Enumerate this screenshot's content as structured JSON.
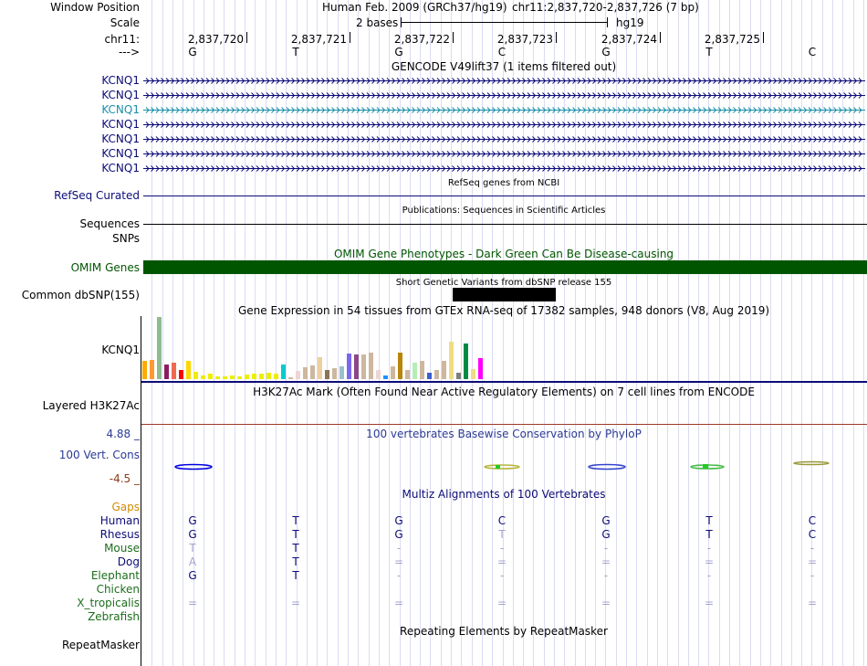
{
  "header": {
    "window_position_label": "Window Position",
    "assembly": "Human Feb. 2009 (GRCh37/hg19)",
    "position": "chr11:2,837,720-2,837,726 (7 bp)",
    "scale_label": "Scale",
    "scale_text": "2 bases",
    "scale_assembly": "hg19",
    "chrom_label": "chr11:",
    "strand_label": "--->",
    "positions": [
      "2,837,720",
      "2,837,721",
      "2,837,722",
      "2,837,723",
      "2,837,724",
      "2,837,725"
    ],
    "bases": [
      "G",
      "T",
      "G",
      "C",
      "G",
      "T",
      "C"
    ]
  },
  "gencode": {
    "title": "GENCODE V49lift37 (1 items filtered out)",
    "items": [
      {
        "label": "KCNQ1",
        "color": "#0c0c78"
      },
      {
        "label": "KCNQ1",
        "color": "#0c0c78"
      },
      {
        "label": "KCNQ1",
        "color": "#1a8fa9"
      },
      {
        "label": "KCNQ1",
        "color": "#0c0c78"
      },
      {
        "label": "KCNQ1",
        "color": "#0c0c78"
      },
      {
        "label": "KCNQ1",
        "color": "#0c0c78"
      },
      {
        "label": "KCNQ1",
        "color": "#0c0c78"
      }
    ]
  },
  "refseq": {
    "title": "RefSeq genes from NCBI",
    "label": "RefSeq Curated",
    "color": "#0c0c78"
  },
  "pubs": {
    "title": "Publications: Sequences in Scientific Articles",
    "label": "Sequences"
  },
  "snps_label": "SNPs",
  "omim": {
    "title": "OMIM Gene Phenotypes - Dark Green Can Be Disease-causing",
    "label": "OMIM Genes",
    "color": "#005500"
  },
  "dbsnp": {
    "title": "Short Genetic Variants from dbSNP release 155",
    "label": "Common dbSNP(155)"
  },
  "gtex": {
    "title": "Gene Expression in 54 tissues from GTEx RNA-seq of 17382 samples, 948 donors (V8, Aug 2019)",
    "label": "KCNQ1",
    "tissues": [
      {
        "color": "#ffaa00",
        "value": 0.29
      },
      {
        "color": "#ff9933",
        "value": 0.31
      },
      {
        "color": "#8fbc8f",
        "value": 1.0
      },
      {
        "color": "#8b1c62",
        "value": 0.24
      },
      {
        "color": "#ee6a50",
        "value": 0.26
      },
      {
        "color": "#ff0000",
        "value": 0.14
      },
      {
        "color": "#ffd700",
        "value": 0.29
      },
      {
        "color": "#eeee00",
        "value": 0.12
      },
      {
        "color": "#eeee00",
        "value": 0.06
      },
      {
        "color": "#eeee00",
        "value": 0.09
      },
      {
        "color": "#eeee00",
        "value": 0.04
      },
      {
        "color": "#eeee00",
        "value": 0.04
      },
      {
        "color": "#eeee00",
        "value": 0.06
      },
      {
        "color": "#eeee00",
        "value": 0.04
      },
      {
        "color": "#eeee00",
        "value": 0.07
      },
      {
        "color": "#eeee00",
        "value": 0.09
      },
      {
        "color": "#eeee00",
        "value": 0.09
      },
      {
        "color": "#eeee00",
        "value": 0.11
      },
      {
        "color": "#eeee00",
        "value": 0.09
      },
      {
        "color": "#00cdcd",
        "value": 0.23
      },
      {
        "color": "#cdb79e",
        "value": 0.03
      },
      {
        "color": "#eed5d2",
        "value": 0.13
      },
      {
        "color": "#cdb79e",
        "value": 0.19
      },
      {
        "color": "#cdb79e",
        "value": 0.22
      },
      {
        "color": "#eecfa1",
        "value": 0.36
      },
      {
        "color": "#8b7355",
        "value": 0.14
      },
      {
        "color": "#cdb79e",
        "value": 0.18
      },
      {
        "color": "#9ac0cd",
        "value": 0.2
      },
      {
        "color": "#7a67ee",
        "value": 0.41
      },
      {
        "color": "#8b4789",
        "value": 0.4
      },
      {
        "color": "#cdb79e",
        "value": 0.39
      },
      {
        "color": "#cdb79e",
        "value": 0.43
      },
      {
        "color": "#eed5d2",
        "value": 0.15
      },
      {
        "color": "#1e90ff",
        "value": 0.06
      },
      {
        "color": "#cdb79e",
        "value": 0.21
      },
      {
        "color": "#b8860b",
        "value": 0.43
      },
      {
        "color": "#cdb79e",
        "value": 0.15
      },
      {
        "color": "#b4eeb4",
        "value": 0.26
      },
      {
        "color": "#cdb79e",
        "value": 0.3
      },
      {
        "color": "#3a5fcd",
        "value": 0.11
      },
      {
        "color": "#cdb79e",
        "value": 0.15
      },
      {
        "color": "#cdb79e",
        "value": 0.3
      },
      {
        "color": "#eedd82",
        "value": 0.6
      },
      {
        "color": "#7f7f7f",
        "value": 0.11
      },
      {
        "color": "#008b45",
        "value": 0.57
      },
      {
        "color": "#eedd82",
        "value": 0.16
      },
      {
        "color": "#ff00ff",
        "value": 0.34
      }
    ]
  },
  "h3k27ac": {
    "title": "H3K27Ac Mark (Often Found Near Active Regulatory Elements) on 7 cell lines from ENCODE",
    "label": "Layered H3K27Ac"
  },
  "phylop": {
    "title": "100 vertebrates Basewise Conservation by PhyloP",
    "label": "100 Vert. Cons",
    "max": "4.88 _",
    "min": "-4.5 _",
    "color": "#2b3a95"
  },
  "multiz": {
    "title": "Multiz Alignments of 100 Vertebrates",
    "gaps_label": "Gaps",
    "gaps_color": "#d08c00",
    "species": [
      {
        "name": "Human",
        "color": "#0c0c78",
        "bases": [
          "G",
          "T",
          "G",
          "C",
          "G",
          "T",
          "C"
        ]
      },
      {
        "name": "Rhesus",
        "color": "#0c0c78",
        "bases": [
          "G",
          "T",
          "G",
          "T",
          "G",
          "T",
          "C"
        ]
      },
      {
        "name": "Mouse",
        "color": "#1c6e1c",
        "bases": [
          "T",
          "T",
          "-",
          "-",
          "-",
          "-",
          "-"
        ]
      },
      {
        "name": "Dog",
        "color": "#0c0c78",
        "bases": [
          "A",
          "T",
          "=",
          "=",
          "=",
          "=",
          "="
        ]
      },
      {
        "name": "Elephant",
        "color": "#1c6e1c",
        "bases": [
          "G",
          "T",
          "-",
          "-",
          "-",
          "-",
          "-"
        ]
      },
      {
        "name": "Chicken",
        "color": "#1c6e1c",
        "bases": [
          "",
          "",
          "",
          "",
          "",
          "",
          ""
        ]
      },
      {
        "name": "X_tropicalis",
        "color": "#1c6e1c",
        "bases": [
          "=",
          "=",
          "=",
          "=",
          "=",
          "=",
          "="
        ]
      },
      {
        "name": "Zebrafish",
        "color": "#1c6e1c",
        "bases": [
          "",
          "",
          "",
          "",
          "",
          "",
          ""
        ]
      }
    ]
  },
  "repeatmasker": {
    "title": "Repeating Elements by RepeatMasker",
    "label": "RepeatMasker"
  }
}
